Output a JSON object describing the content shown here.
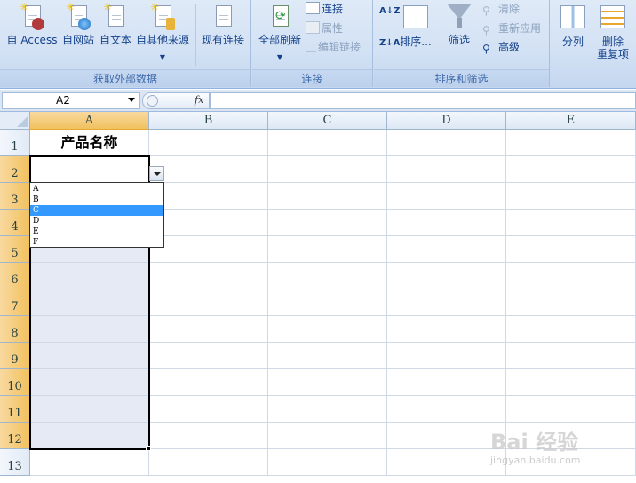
{
  "ribbon": {
    "groups": {
      "external_data": {
        "label": "获取外部数据",
        "buttons": [
          "自 Access",
          "自网站",
          "自文本",
          "自其他来源",
          "现有连接"
        ]
      },
      "connections": {
        "label": "连接",
        "refresh_all": "全部刷新",
        "connections": "连接",
        "properties": "属性",
        "edit_links": "编辑链接"
      },
      "sort_filter": {
        "label": "排序和筛选",
        "sort": "排序...",
        "filter": "筛选",
        "clear": "清除",
        "reapply": "重新应用",
        "advanced": "高级",
        "sort_az_icon": "A↓Z",
        "sort_za_icon": "Z↓A"
      },
      "data_tools": {
        "text_to_columns": "分列",
        "remove_dup_1": "删除",
        "remove_dup_2": "重复项"
      }
    }
  },
  "formula_bar": {
    "name_box": "A2",
    "fx": "fx",
    "formula": ""
  },
  "sheet": {
    "columns": [
      "A",
      "B",
      "C",
      "D",
      "E"
    ],
    "rows": [
      "1",
      "2",
      "3",
      "4",
      "5",
      "6",
      "7",
      "8",
      "9",
      "10",
      "11",
      "12",
      "13"
    ],
    "a1": "产品名称",
    "a2": ""
  },
  "dropdown": {
    "options": [
      "A",
      "B",
      "C",
      "D",
      "E",
      "F"
    ],
    "selected_index": 2
  },
  "watermark": {
    "text": "Bai 经验",
    "url": "jingyan.baidu.com"
  }
}
